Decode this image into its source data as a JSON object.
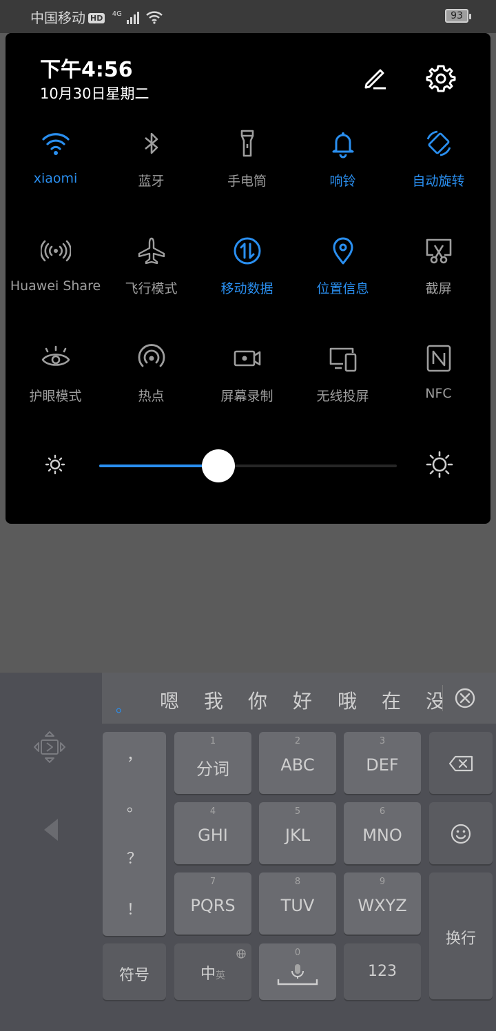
{
  "status_bar": {
    "carrier": "中国移动",
    "hd": "HD",
    "network": "4G",
    "battery": "93"
  },
  "panel": {
    "time": "下午4:56",
    "date": "10月30日星期二"
  },
  "tiles": [
    {
      "label": "xiaomi",
      "icon": "wifi-icon",
      "on": true
    },
    {
      "label": "蓝牙",
      "icon": "bluetooth-icon",
      "on": false
    },
    {
      "label": "手电筒",
      "icon": "flashlight-icon",
      "on": false
    },
    {
      "label": "响铃",
      "icon": "bell-icon",
      "on": true
    },
    {
      "label": "自动旋转",
      "icon": "auto-rotate-icon",
      "on": true
    },
    {
      "label": "Huawei Share",
      "icon": "huawei-share-icon",
      "on": false
    },
    {
      "label": "飞行模式",
      "icon": "airplane-icon",
      "on": false
    },
    {
      "label": "移动数据",
      "icon": "mobile-data-icon",
      "on": true
    },
    {
      "label": "位置信息",
      "icon": "location-icon",
      "on": true
    },
    {
      "label": "截屏",
      "icon": "screenshot-icon",
      "on": false
    },
    {
      "label": "护眼模式",
      "icon": "eye-icon",
      "on": false
    },
    {
      "label": "热点",
      "icon": "hotspot-icon",
      "on": false
    },
    {
      "label": "屏幕录制",
      "icon": "screen-record-icon",
      "on": false
    },
    {
      "label": "无线投屏",
      "icon": "wireless-projection-icon",
      "on": false
    },
    {
      "label": "NFC",
      "icon": "nfc-icon",
      "on": false
    }
  ],
  "brightness": {
    "value": 0.4
  },
  "colors": {
    "accent": "#2a8ff0",
    "inactive": "#9e9e9e",
    "panel_bg": "#000000"
  },
  "keyboard": {
    "candidate_dot": "。",
    "candidates": [
      "嗯",
      "我",
      "你",
      "好",
      "哦",
      "在",
      "没"
    ],
    "punctuation": [
      "，",
      "。",
      "？",
      "！"
    ],
    "keys": [
      {
        "num": "1",
        "label": "分词"
      },
      {
        "num": "2",
        "label": "ABC"
      },
      {
        "num": "3",
        "label": "DEF"
      },
      {
        "num": "4",
        "label": "GHI"
      },
      {
        "num": "5",
        "label": "JKL"
      },
      {
        "num": "6",
        "label": "MNO"
      },
      {
        "num": "7",
        "label": "PQRS"
      },
      {
        "num": "8",
        "label": "TUV"
      },
      {
        "num": "9",
        "label": "WXYZ"
      }
    ],
    "symbols_label": "符号",
    "lang_label": "中",
    "lang_sub": "英",
    "space_num": "0",
    "num_label": "123",
    "enter_label": "换行"
  }
}
